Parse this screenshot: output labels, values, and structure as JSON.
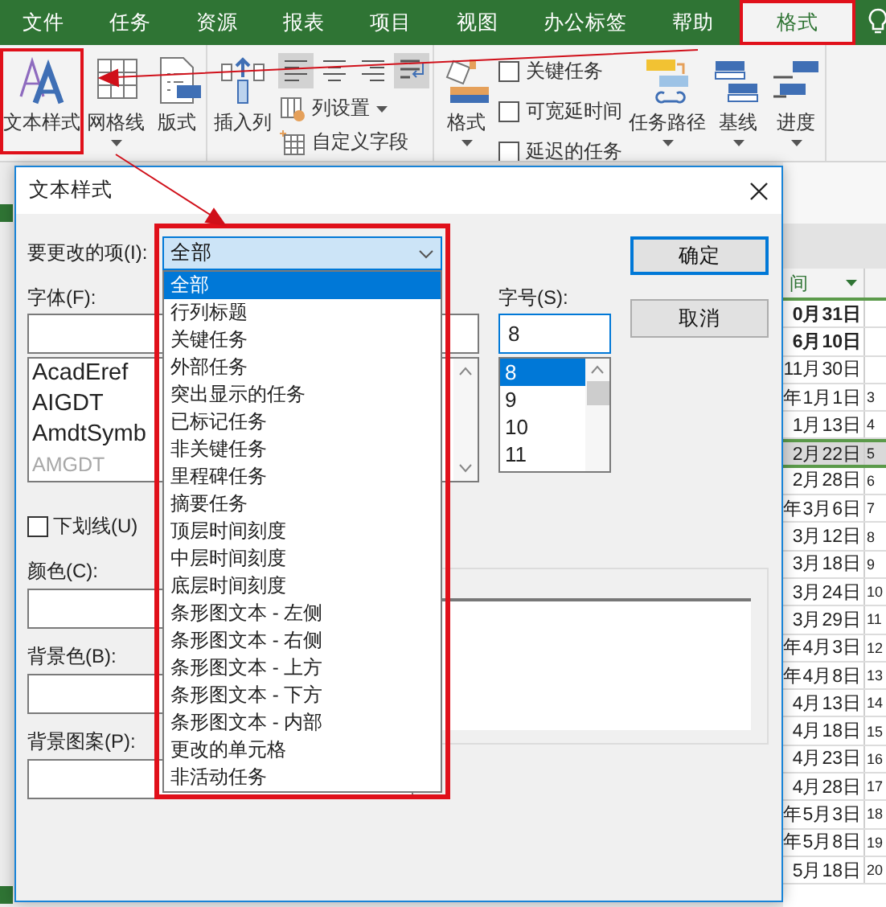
{
  "tabs": [
    {
      "label": "文件",
      "selected": false,
      "highlighted": false
    },
    {
      "label": "任务",
      "selected": false,
      "highlighted": false
    },
    {
      "label": "资源",
      "selected": false,
      "highlighted": false
    },
    {
      "label": "报表",
      "selected": false,
      "highlighted": false
    },
    {
      "label": "项目",
      "selected": false,
      "highlighted": false
    },
    {
      "label": "视图",
      "selected": false,
      "highlighted": false
    },
    {
      "label": "办公标签",
      "selected": false,
      "highlighted": false
    },
    {
      "label": "帮助",
      "selected": false,
      "highlighted": false
    },
    {
      "label": "格式",
      "selected": true,
      "highlighted": true
    }
  ],
  "ribbon": {
    "groups": [
      {
        "items": [
          {
            "kind": "large",
            "label": "文本样式",
            "caret": false,
            "highlighted": true
          },
          {
            "kind": "large",
            "label": "网格线",
            "caret": true,
            "highlighted": false
          },
          {
            "kind": "large",
            "label": "版式",
            "caret": false,
            "highlighted": false
          }
        ]
      },
      {
        "items": [
          {
            "kind": "large",
            "label": "插入列",
            "caret": false,
            "highlighted": false
          },
          {
            "kind": "toggle",
            "on": true
          },
          {
            "kind": "toggle",
            "on": false
          },
          {
            "kind": "toggle",
            "on": false
          },
          {
            "kind": "toggle",
            "on": true
          },
          {
            "kind": "small",
            "label": "列设置",
            "caret": true
          },
          {
            "kind": "small",
            "label": "自定义字段",
            "caret": false
          }
        ]
      },
      {
        "items": [
          {
            "kind": "large",
            "label": "格式",
            "caret": true,
            "highlighted": false
          },
          {
            "kind": "checkbox",
            "label": "关键任务",
            "checked": false
          },
          {
            "kind": "checkbox",
            "label": "可宽延时间",
            "checked": false
          },
          {
            "kind": "checkbox",
            "label": "延迟的任务",
            "checked": false
          },
          {
            "kind": "large",
            "label": "任务路径",
            "caret": true,
            "highlighted": false
          },
          {
            "kind": "large",
            "label": "基线",
            "caret": true,
            "highlighted": false
          },
          {
            "kind": "large",
            "label": "进度",
            "caret": true,
            "highlighted": false
          }
        ]
      }
    ]
  },
  "dialog": {
    "title": "文本样式",
    "item_label": "要更改的项(I):",
    "item_value": "全部",
    "item_highlighted": true,
    "item_options": [
      {
        "label": "全部",
        "selected": true
      },
      {
        "label": "行列标题",
        "selected": false
      },
      {
        "label": "关键任务",
        "selected": false
      },
      {
        "label": "外部任务",
        "selected": false
      },
      {
        "label": "突出显示的任务",
        "selected": false
      },
      {
        "label": "已标记任务",
        "selected": false
      },
      {
        "label": "非关键任务",
        "selected": false
      },
      {
        "label": "里程碑任务",
        "selected": false
      },
      {
        "label": "摘要任务",
        "selected": false
      },
      {
        "label": "顶层时间刻度",
        "selected": false
      },
      {
        "label": "中层时间刻度",
        "selected": false
      },
      {
        "label": "底层时间刻度",
        "selected": false
      },
      {
        "label": "条形图文本 - 左侧",
        "selected": false
      },
      {
        "label": "条形图文本 - 右侧",
        "selected": false
      },
      {
        "label": "条形图文本 - 上方",
        "selected": false
      },
      {
        "label": "条形图文本 - 下方",
        "selected": false
      },
      {
        "label": "条形图文本 - 内部",
        "selected": false
      },
      {
        "label": "更改的单元格",
        "selected": false
      },
      {
        "label": "非活动任务",
        "selected": false
      }
    ],
    "font_label": "字体(F):",
    "fonts": [
      {
        "name": "AcadEref",
        "disabled": false
      },
      {
        "name": "AIGDT",
        "disabled": false
      },
      {
        "name": "AmdtSymb",
        "disabled": false
      },
      {
        "name": "AMGDT",
        "disabled": true
      }
    ],
    "size_label": "字号(S):",
    "size_value": "8",
    "sizes": [
      {
        "label": "8",
        "selected": true
      },
      {
        "label": "9",
        "selected": false
      },
      {
        "label": "10",
        "selected": false
      },
      {
        "label": "11",
        "selected": false
      }
    ],
    "buttons": [
      {
        "label": "确定",
        "default": true
      },
      {
        "label": "取消",
        "default": false
      }
    ],
    "underline": {
      "label": "下划线(U)",
      "checked": false
    },
    "color_label": "颜色(C):",
    "background_color_label": "背景色(B):",
    "background_pattern_label": "背景图案(P):"
  },
  "table": {
    "columns": [
      "间"
    ],
    "rows": [
      {
        "date": "0月31日",
        "bold": true,
        "selected": false
      },
      {
        "date": "6月10日",
        "bold": true,
        "selected": false
      },
      {
        "date": "11月30日",
        "bold": false,
        "selected": false
      },
      {
        "date": "年1月1日",
        "number": "3",
        "bold": false,
        "selected": false
      },
      {
        "date": "1月13日",
        "number": "4",
        "bold": false,
        "selected": false
      },
      {
        "date": "2月22日",
        "number": "5",
        "bold": false,
        "selected": true
      },
      {
        "date": "2月28日",
        "number": "6",
        "bold": false,
        "selected": false
      },
      {
        "date": "年3月6日",
        "number": "7",
        "bold": false,
        "selected": false
      },
      {
        "date": "3月12日",
        "number": "8",
        "bold": false,
        "selected": false
      },
      {
        "date": "3月18日",
        "number": "9",
        "bold": false,
        "selected": false
      },
      {
        "date": "3月24日",
        "number": "10",
        "bold": false,
        "selected": false
      },
      {
        "date": "3月29日",
        "number": "11",
        "bold": false,
        "selected": false
      },
      {
        "date": "年4月3日",
        "number": "12",
        "bold": false,
        "selected": false
      },
      {
        "date": "年4月8日",
        "number": "13",
        "bold": false,
        "selected": false
      },
      {
        "date": "4月13日",
        "number": "14",
        "bold": false,
        "selected": false
      },
      {
        "date": "4月18日",
        "number": "15",
        "bold": false,
        "selected": false
      },
      {
        "date": "4月23日",
        "number": "16",
        "bold": false,
        "selected": false
      },
      {
        "date": "4月28日",
        "number": "17",
        "bold": false,
        "selected": false
      },
      {
        "date": "年5月3日",
        "number": "18",
        "bold": false,
        "selected": false
      },
      {
        "date": "年5月8日",
        "number": "19",
        "bold": false,
        "selected": false
      },
      {
        "date": "5月18日",
        "number": "20",
        "bold": false,
        "selected": false
      }
    ]
  }
}
